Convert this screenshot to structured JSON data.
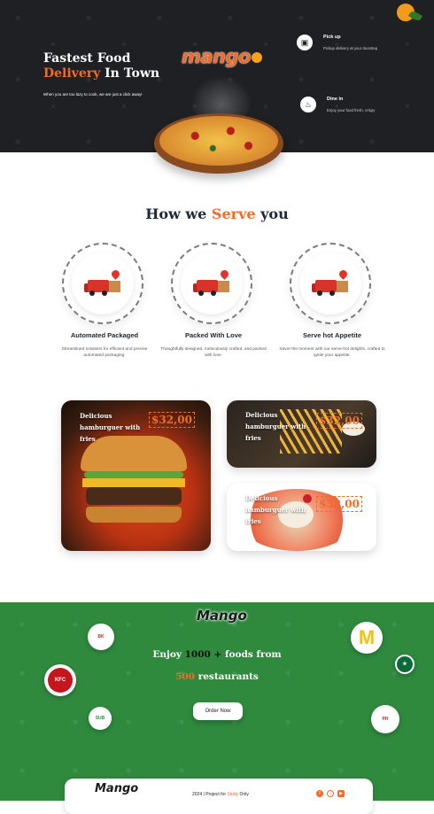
{
  "hero": {
    "title_line1": "Fastest Food",
    "title_highlight": "Delivery",
    "title_line2_rest": " In Town",
    "subtitle": "When you are too lazy to cook, we are just a click away!",
    "logo": "mango",
    "services": [
      {
        "title": "Pick up",
        "desc": "Pickup delivery at your doorstep",
        "icon": "shopping-bag-icon"
      },
      {
        "title": "Dine in",
        "desc": "Enjoy your food fresh, crispy",
        "icon": "cutlery-icon"
      }
    ]
  },
  "serve": {
    "title_pre": "How we ",
    "title_highlight": "Serve",
    "title_post": " you",
    "cards": [
      {
        "title": "Automated Packaged",
        "desc": "Streamlined solutions for efficient and precise automated packaging."
      },
      {
        "title": "Packed With Love",
        "desc": "Thoughtfully designed, meticulously crafted, and packed with love."
      },
      {
        "title": "Serve hot Appetite",
        "desc": "Savor the moment with our serve-hot delights, crafted to ignite your appetite."
      }
    ]
  },
  "food": [
    {
      "label": "Delicious hamburguer with fries",
      "price": "$32,00"
    },
    {
      "label": "Delicious hamburguer with fries",
      "price": "$32,00"
    },
    {
      "label": "Delicious hamburguer with fries",
      "price": "$32,00"
    }
  ],
  "promo": {
    "logo": "Mango",
    "line1_pre": "Enjoy ",
    "line1_num": "1000 +",
    "line1_post": " foods from",
    "line2_num": "500",
    "line2_post": " restaurants",
    "button": "Order Now",
    "brands": [
      "burger-king-logo",
      "kfc-logo",
      "subway-logo",
      "mcdonalds-logo",
      "starbucks-logo",
      "pizza-hut-logo"
    ]
  },
  "footer": {
    "logo": "Mango",
    "text_pre": "2024 | Project for ",
    "text_highlight": "Study",
    "text_post": " Only",
    "socials": [
      "facebook-icon",
      "instagram-icon",
      "youtube-icon"
    ]
  }
}
